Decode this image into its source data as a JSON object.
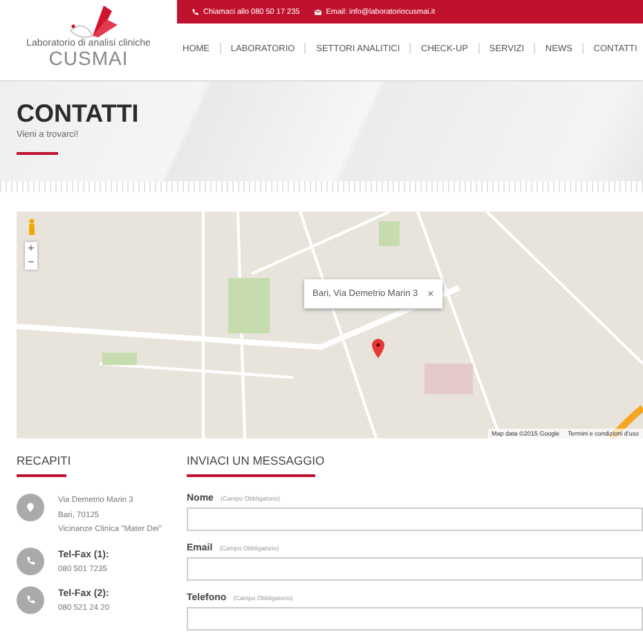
{
  "logo": {
    "tagline": "Laboratorio di analisi cliniche",
    "name": "CUSMAI"
  },
  "top_bar": {
    "phone": "Chiamaci allo 080 50 17 235",
    "email": "Email: info@laboratoriocusmai.it"
  },
  "nav": [
    "HOME",
    "LABORATORIO",
    "SETTORI ANALITICI",
    "CHECK-UP",
    "SERVIZI",
    "NEWS",
    "CONTATTI"
  ],
  "hero": {
    "title": "CONTATTI",
    "subtitle": "Vieni a trovarci!"
  },
  "map": {
    "zoom_in": "+",
    "zoom_out": "−",
    "info_window": "Bari, Via Demetrio Marin 3",
    "close": "×",
    "attribution": "Map data ©2015 Google",
    "terms": "Termini e condizioni d'uso"
  },
  "recapiti": {
    "title": "RECAPITI",
    "items": [
      {
        "kind": "address",
        "lines": [
          "Via Demetrio Marin 3",
          "Bari, 70125",
          "Vicinanze Clinica \"Mater Dei\""
        ]
      },
      {
        "kind": "phone",
        "label": "Tel-Fax (1):",
        "lines": [
          "080 501 7235"
        ]
      },
      {
        "kind": "phone",
        "label": "Tel-Fax (2):",
        "lines": [
          "080 521 24 20"
        ]
      }
    ]
  },
  "form": {
    "title": "INVIACI UN MESSAGGIO",
    "fields": [
      {
        "label": "Nome",
        "hint": "(Campo Obbligatorio)"
      },
      {
        "label": "Email",
        "hint": "(Campo Obbligatorio)"
      },
      {
        "label": "Telefono",
        "hint": "(Campo Obbligatorio)"
      }
    ]
  }
}
